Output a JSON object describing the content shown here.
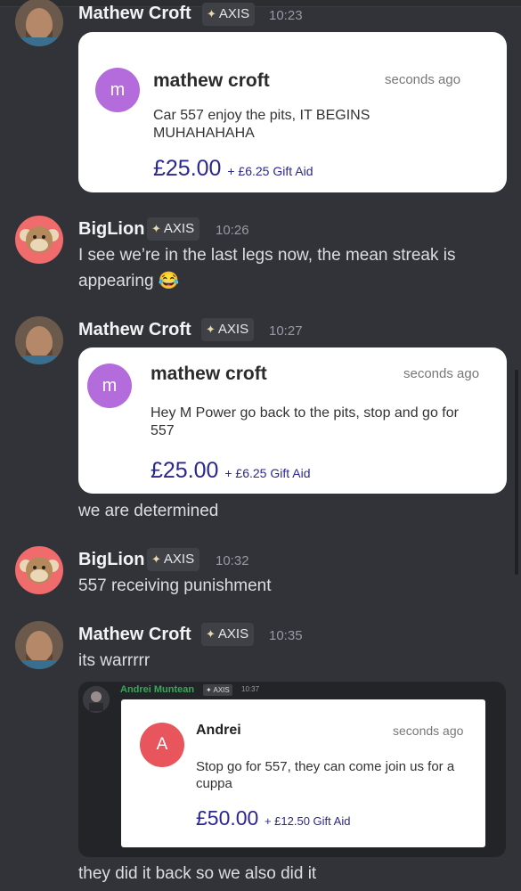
{
  "tag_label": "AXIS",
  "gift_suffix": "Gift Aid",
  "messages": [
    {
      "author": "Mathew Croft",
      "time": "10:23",
      "card": {
        "name": "mathew croft",
        "ago": "seconds ago",
        "initial": "m",
        "text": "Car 557 enjoy the pits, IT BEGINS MUHAHAHAHA",
        "amount": "£25.00",
        "gift": "+ £6.25 Gift Aid"
      }
    },
    {
      "author": "BigLion",
      "time": "10:26",
      "text_lines": [
        "I see we’re in the last legs now, the mean streak is",
        "appearing 😂"
      ]
    },
    {
      "author": "Mathew Croft",
      "time": "10:27",
      "card": {
        "name": "mathew croft",
        "ago": "seconds ago",
        "initial": "m",
        "text": "Hey M Power go back to the pits, stop and go for 557",
        "amount": "£25.00",
        "gift": "+ £6.25 Gift Aid"
      },
      "after_text": "we are determined"
    },
    {
      "author": "BigLion",
      "time": "10:32",
      "text": "557 receiving punishment"
    },
    {
      "author": "Mathew Croft",
      "time": "10:35",
      "text": "its warrrrr",
      "embed": {
        "author": "Andrei Muntean",
        "time": "10:37",
        "card": {
          "name": "Andrei",
          "ago": "seconds ago",
          "initial": "A",
          "text": "Stop go for 557, they can come join us for a cuppa",
          "amount": "£50.00",
          "gift": "+ £12.50 Gift Aid"
        }
      },
      "after_text": "they did it back so we also did it"
    }
  ],
  "colors": {
    "background": "#313338",
    "accent_amount": "#2b2791",
    "card_avatar_m": "#b46cdc",
    "card_avatar_a": "#e8555d",
    "embed_author": "#3ba55c"
  }
}
